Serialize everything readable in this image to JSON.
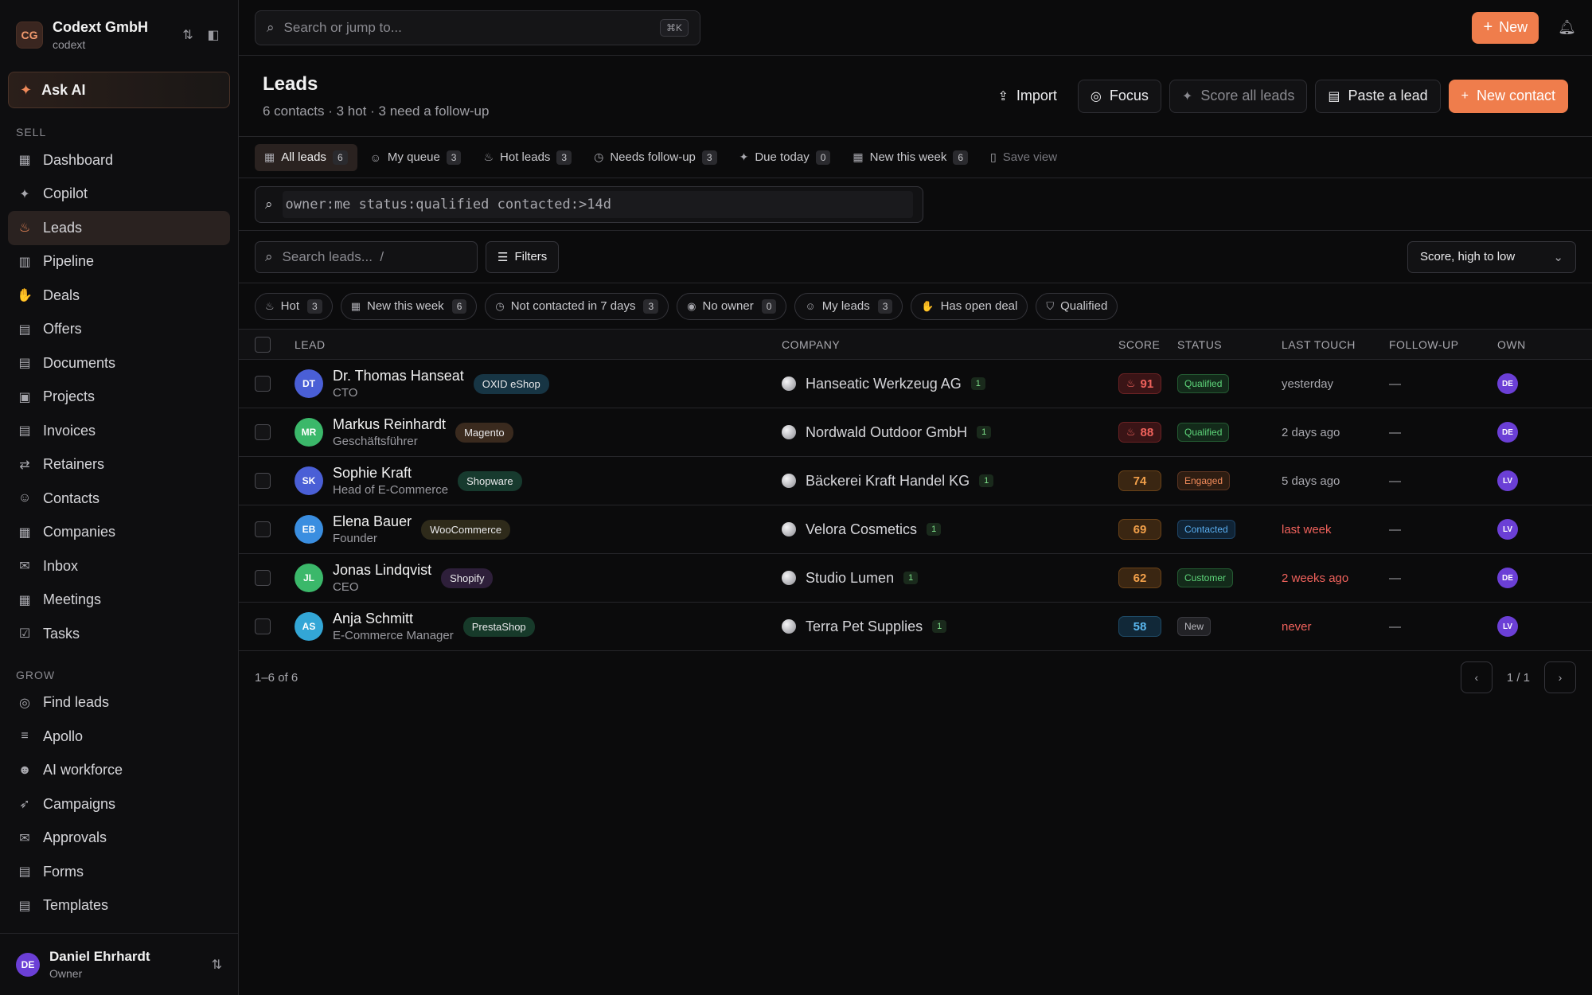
{
  "workspace": {
    "initials": "CG",
    "name": "Codext GmbH",
    "slug": "codext"
  },
  "sidebar": {
    "ask_ai": "Ask AI",
    "section_sell": "SELL",
    "sell": [
      {
        "label": "Dashboard",
        "icon": "dashboard-icon"
      },
      {
        "label": "Copilot",
        "icon": "sparkle-icon"
      },
      {
        "label": "Leads",
        "icon": "flame-icon",
        "active": true
      },
      {
        "label": "Pipeline",
        "icon": "pipeline-icon"
      },
      {
        "label": "Deals",
        "icon": "handshake-icon"
      },
      {
        "label": "Offers",
        "icon": "document-icon"
      },
      {
        "label": "Documents",
        "icon": "file-text-icon"
      },
      {
        "label": "Projects",
        "icon": "folder-icon"
      },
      {
        "label": "Invoices",
        "icon": "receipt-icon"
      },
      {
        "label": "Retainers",
        "icon": "repeat-icon"
      },
      {
        "label": "Contacts",
        "icon": "users-icon"
      },
      {
        "label": "Companies",
        "icon": "building-icon"
      },
      {
        "label": "Inbox",
        "icon": "mail-icon"
      },
      {
        "label": "Meetings",
        "icon": "calendar-icon"
      },
      {
        "label": "Tasks",
        "icon": "checkbox-icon"
      }
    ],
    "section_grow": "GROW",
    "grow": [
      {
        "label": "Find leads",
        "icon": "target-icon"
      },
      {
        "label": "Apollo",
        "icon": "database-icon"
      },
      {
        "label": "AI workforce",
        "icon": "bot-icon"
      },
      {
        "label": "Campaigns",
        "icon": "rocket-icon"
      },
      {
        "label": "Approvals",
        "icon": "mail-check-icon"
      },
      {
        "label": "Forms",
        "icon": "form-icon"
      },
      {
        "label": "Templates",
        "icon": "template-icon"
      }
    ]
  },
  "user": {
    "initials": "DE",
    "name": "Daniel Ehrhardt",
    "role": "Owner"
  },
  "topbar": {
    "search_placeholder": "Search or jump to...",
    "shortcut": "⌘K",
    "new_label": "New"
  },
  "page": {
    "title": "Leads",
    "subtitle": "6 contacts · 3 hot · 3 need a follow-up",
    "buttons": {
      "import": "Import",
      "focus": "Focus",
      "score_all": "Score all leads",
      "paste": "Paste a lead",
      "new_contact": "New contact"
    }
  },
  "views": [
    {
      "label": "All leads",
      "count": "6",
      "icon": "grid-icon",
      "active": true
    },
    {
      "label": "My queue",
      "count": "3",
      "icon": "user-icon"
    },
    {
      "label": "Hot leads",
      "count": "3",
      "icon": "flame-icon"
    },
    {
      "label": "Needs follow-up",
      "count": "3",
      "icon": "clock-icon"
    },
    {
      "label": "Due today",
      "count": "0",
      "icon": "sparkle-icon"
    },
    {
      "label": "New this week",
      "count": "6",
      "icon": "calendar-icon"
    }
  ],
  "save_view": "Save view",
  "query": "owner:me status:qualified contacted:>14d",
  "list_search_placeholder": "Search leads...  /",
  "filters_label": "Filters",
  "sort_label": "Score, high to low",
  "chips": [
    {
      "label": "Hot",
      "count": "3",
      "icon": "flame-icon"
    },
    {
      "label": "New this week",
      "count": "6",
      "icon": "calendar-icon"
    },
    {
      "label": "Not contacted in 7 days",
      "count": "3",
      "icon": "clock-icon"
    },
    {
      "label": "No owner",
      "count": "0",
      "icon": "user-circle-icon"
    },
    {
      "label": "My leads",
      "count": "3",
      "icon": "user-icon"
    },
    {
      "label": "Has open deal",
      "icon": "handshake-icon"
    },
    {
      "label": "Qualified",
      "icon": "shield-check-icon"
    }
  ],
  "columns": {
    "lead": "LEAD",
    "company": "COMPANY",
    "score": "SCORE",
    "status": "STATUS",
    "last_touch": "LAST TOUCH",
    "follow_up": "FOLLOW-UP",
    "owner": "OWN"
  },
  "rows": [
    {
      "initials": "DT",
      "name": "Dr. Thomas Hanseat",
      "title": "CTO",
      "tag": "OXID eShop",
      "company": "Hanseatic Werkzeug AG",
      "contacts": "1",
      "score": "91",
      "hot": true,
      "status": "Qualified",
      "last_touch": "yesterday",
      "last_red": false,
      "follow_up": "—",
      "owner": "DE",
      "avatar": "#4a5fd6",
      "tag_bg": "#173544",
      "score_kind": "red",
      "status_kind": "green"
    },
    {
      "initials": "MR",
      "name": "Markus Reinhardt",
      "title": "Geschäftsführer",
      "tag": "Magento",
      "company": "Nordwald Outdoor GmbH",
      "contacts": "1",
      "score": "88",
      "hot": true,
      "status": "Qualified",
      "last_touch": "2 days ago",
      "last_red": false,
      "follow_up": "—",
      "owner": "DE",
      "avatar": "#3bb86a",
      "tag_bg": "#3a2a1e",
      "score_kind": "red",
      "status_kind": "green"
    },
    {
      "initials": "SK",
      "name": "Sophie Kraft",
      "title": "Head of E-Commerce",
      "tag": "Shopware",
      "company": "Bäckerei Kraft Handel KG",
      "contacts": "1",
      "score": "74",
      "hot": false,
      "status": "Engaged",
      "last_touch": "5 days ago",
      "last_red": false,
      "follow_up": "—",
      "owner": "LV",
      "avatar": "#4a5fd6",
      "tag_bg": "#173a2e",
      "score_kind": "orange",
      "status_kind": "orange"
    },
    {
      "initials": "EB",
      "name": "Elena Bauer",
      "title": "Founder",
      "tag": "WooCommerce",
      "company": "Velora Cosmetics",
      "contacts": "1",
      "score": "69",
      "hot": false,
      "status": "Contacted",
      "last_touch": "last week",
      "last_red": true,
      "follow_up": "—",
      "owner": "LV",
      "avatar": "#3a8ee0",
      "tag_bg": "#2e2a1a",
      "score_kind": "orange",
      "status_kind": "blue"
    },
    {
      "initials": "JL",
      "name": "Jonas Lindqvist",
      "title": "CEO",
      "tag": "Shopify",
      "company": "Studio Lumen",
      "contacts": "1",
      "score": "62",
      "hot": false,
      "status": "Customer",
      "last_touch": "2 weeks ago",
      "last_red": true,
      "follow_up": "—",
      "owner": "DE",
      "avatar": "#3bb86a",
      "tag_bg": "#2e1f3a",
      "score_kind": "orange",
      "status_kind": "green"
    },
    {
      "initials": "AS",
      "name": "Anja Schmitt",
      "title": "E-Commerce Manager",
      "tag": "PrestaShop",
      "company": "Terra Pet Supplies",
      "contacts": "1",
      "score": "58",
      "hot": false,
      "status": "New",
      "last_touch": "never",
      "last_red": true,
      "follow_up": "—",
      "owner": "LV",
      "avatar": "#33a6d6",
      "tag_bg": "#173a2a",
      "score_kind": "blue",
      "status_kind": "gray"
    }
  ],
  "footer": {
    "range": "1–6 of 6",
    "page": "1 / 1"
  },
  "colors": {
    "accent": "#ef7d4c",
    "bg": "#0b0b0c",
    "owner_avatar": "#6b3fd6"
  }
}
